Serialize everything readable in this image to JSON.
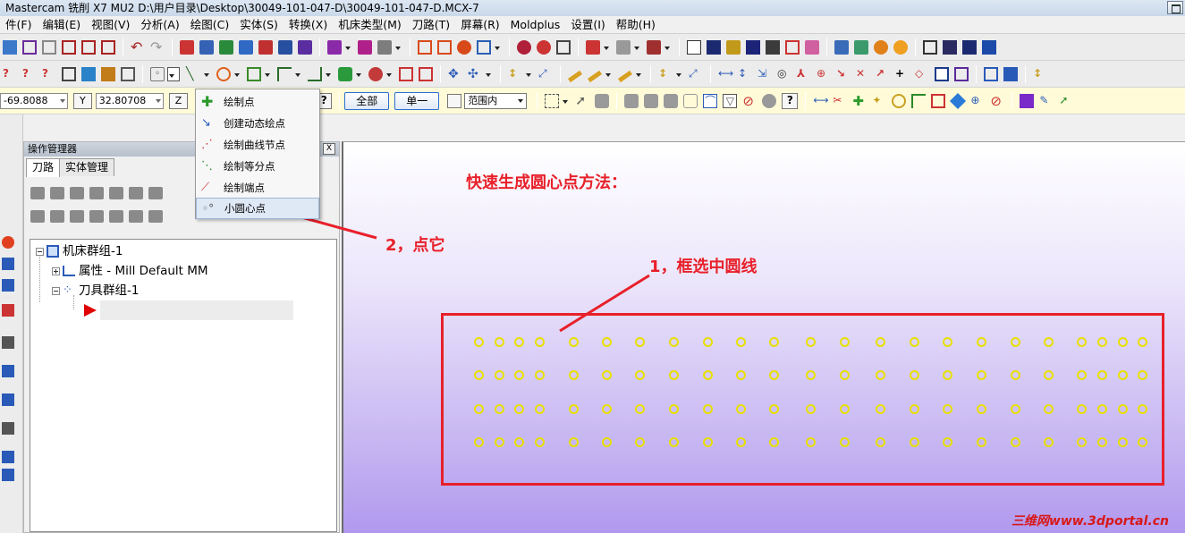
{
  "window": {
    "title": "Mastercam 铣削 X7 MU2  D:\\用户目录\\Desktop\\30049-101-047-D\\30049-101-047-D.MCX-7"
  },
  "menu": [
    "件(F)",
    "编辑(E)",
    "视图(V)",
    "分析(A)",
    "绘图(C)",
    "实体(S)",
    "转换(X)",
    "机床类型(M)",
    "刀路(T)",
    "屏幕(R)",
    "Moldplus",
    "设置(I)",
    "帮助(H)"
  ],
  "coords": {
    "x_value": "-69.8088",
    "y_label": "Y",
    "y_value": "32.80708",
    "z_label": "Z"
  },
  "selection": {
    "all_label": "全部",
    "single_label": "单一",
    "range_value": "范围内"
  },
  "ops_manager": {
    "title": "操作管理器",
    "close": "X",
    "tabs": [
      "刀路",
      "实体管理"
    ],
    "tree": {
      "machine_group": "机床群组-1",
      "properties": "属性 - Mill Default MM",
      "tool_group": "刀具群组-1"
    }
  },
  "point_menu": {
    "items": [
      "绘制点",
      "创建动态绘点",
      "绘制曲线节点",
      "绘制等分点",
      "绘制端点",
      "小圆心点"
    ],
    "highlighted_index": 5
  },
  "annotations": {
    "heading": "快速生成圆心点方法：",
    "step1": "1，框选中圆线",
    "step2": "2，点它"
  },
  "watermark": "三维网www.3dportal.cn",
  "grid": {
    "rows": 4,
    "columns": 24,
    "circle_color": "#e8e000"
  },
  "colors": {
    "annotation": "#e8202a",
    "circle": "#e8e000"
  }
}
